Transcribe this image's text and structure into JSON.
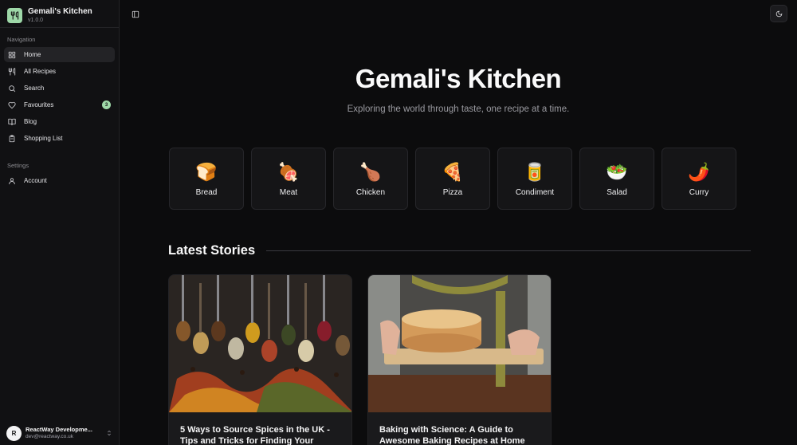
{
  "brand": {
    "title": "Gemali's Kitchen",
    "version": "v1.0.0",
    "accent": "#9ed8a8"
  },
  "sidebar": {
    "navigation_label": "Navigation",
    "items": [
      {
        "label": "Home",
        "icon": "grid-icon",
        "active": true
      },
      {
        "label": "All Recipes",
        "icon": "utensils-icon"
      },
      {
        "label": "Search",
        "icon": "search-icon"
      },
      {
        "label": "Favourites",
        "icon": "heart-icon",
        "badge": "3"
      },
      {
        "label": "Blog",
        "icon": "book-icon"
      },
      {
        "label": "Shopping List",
        "icon": "clipboard-icon"
      }
    ],
    "settings_label": "Settings",
    "settings_items": [
      {
        "label": "Account",
        "icon": "user-icon"
      }
    ]
  },
  "user": {
    "name": "ReactWay Developme...",
    "email": "dev@reactway.co.uk",
    "avatar_text": "R"
  },
  "hero": {
    "title": "Gemali's Kitchen",
    "subtitle": "Exploring the world through taste, one recipe at a time."
  },
  "categories": [
    {
      "label": "Bread",
      "emoji": "🍞"
    },
    {
      "label": "Meat",
      "emoji": "🍖"
    },
    {
      "label": "Chicken",
      "emoji": "🍗"
    },
    {
      "label": "Pizza",
      "emoji": "🍕"
    },
    {
      "label": "Condiment",
      "emoji": "🥫"
    },
    {
      "label": "Salad",
      "emoji": "🥗"
    },
    {
      "label": "Curry",
      "emoji": "🌶️"
    }
  ],
  "stories": {
    "heading": "Latest Stories",
    "items": [
      {
        "title": "5 Ways to Source Spices in the UK - Tips and Tricks for Finding Your"
      },
      {
        "title": "Baking with Science: A Guide to Awesome Baking Recipes at Home"
      }
    ]
  }
}
